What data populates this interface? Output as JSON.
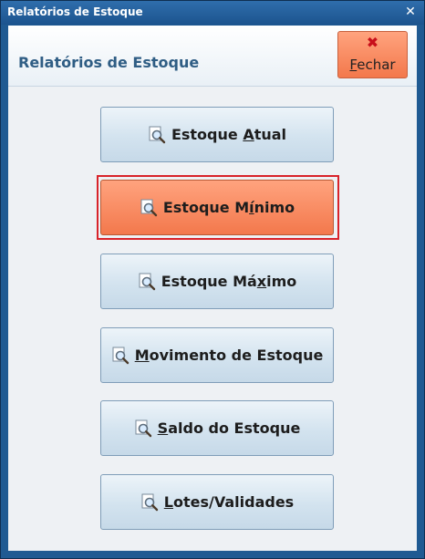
{
  "window": {
    "title": "Relatórios de Estoque",
    "close_glyph": "✕"
  },
  "header": {
    "title": "Relatórios de Estoque",
    "close_button": {
      "label_pre": "",
      "label_mnemonic": "F",
      "label_post": "echar",
      "icon": "close-x-icon",
      "icon_color": "#c8101a"
    }
  },
  "buttons": [
    {
      "id": "estoque-atual",
      "pre": "Estoque ",
      "mnemonic": "A",
      "post": "tual",
      "icon": "magnifier-document-icon",
      "selected": false
    },
    {
      "id": "estoque-minimo",
      "pre": "Estoque M",
      "mnemonic": "í",
      "post": "nimo",
      "icon": "magnifier-document-icon",
      "selected": true
    },
    {
      "id": "estoque-maximo",
      "pre": "Estoque Má",
      "mnemonic": "x",
      "post": "imo",
      "icon": "magnifier-document-icon",
      "selected": false
    },
    {
      "id": "movimento-estoque",
      "pre": "",
      "mnemonic": "M",
      "post": "ovimento de Estoque",
      "icon": "magnifier-document-icon",
      "selected": false
    },
    {
      "id": "saldo-estoque",
      "pre": "",
      "mnemonic": "S",
      "post": "aldo do Estoque",
      "icon": "magnifier-document-icon",
      "selected": false
    },
    {
      "id": "lotes-validades",
      "pre": "",
      "mnemonic": "L",
      "post": "otes/Validades",
      "icon": "magnifier-document-icon",
      "selected": false
    }
  ],
  "colors": {
    "accent_orange": "#f3784c",
    "selection_border": "#d8232a",
    "title_blue": "#2f5d84"
  }
}
